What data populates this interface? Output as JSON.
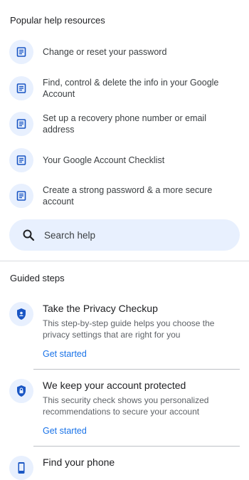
{
  "popular": {
    "title": "Popular help resources",
    "items": [
      {
        "label": "Change or reset your password",
        "icon": "article-icon"
      },
      {
        "label": "Find, control & delete the info in your Google Account",
        "icon": "article-icon"
      },
      {
        "label": "Set up a recovery phone number or email address",
        "icon": "article-icon"
      },
      {
        "label": "Your Google Account Checklist",
        "icon": "article-icon"
      },
      {
        "label": "Create a strong password & a more secure account",
        "icon": "article-icon"
      }
    ]
  },
  "search": {
    "label": "Search help",
    "icon": "search-icon"
  },
  "guided": {
    "title": "Guided steps",
    "items": [
      {
        "title": "Take the Privacy Checkup",
        "description": "This step-by-step guide helps you choose the privacy settings that are right for you",
        "link": "Get started",
        "icon": "privacy-shield-icon"
      },
      {
        "title": "We keep your account protected",
        "description": "This security check shows you personalized recommendations to secure your account",
        "link": "Get started",
        "icon": "security-lock-shield-icon"
      },
      {
        "title": "Find your phone",
        "icon": "phone-icon"
      }
    ]
  },
  "colors": {
    "accent": "#1a73e8",
    "icon_bg": "#e8f0fe",
    "icon_fg": "#1a56c4"
  }
}
